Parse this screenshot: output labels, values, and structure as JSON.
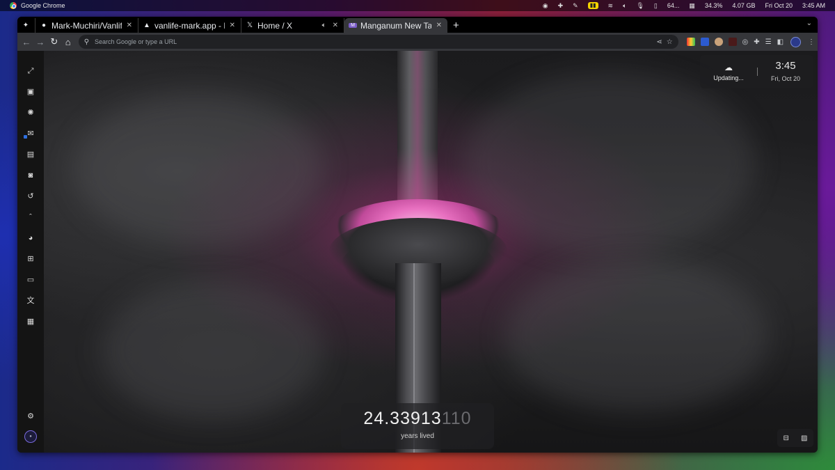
{
  "system_bar": {
    "app_name": "Google Chrome",
    "cpu": "64...",
    "disk": "34.3%",
    "memory": "4.07 GB",
    "date": "Fri Oct 20",
    "time": "3:45 AM"
  },
  "tabs": [
    {
      "title": "Mark-Muchiri/Vanlif",
      "favicon": "github-icon",
      "active": false
    },
    {
      "title": "vanlife-mark.app - D",
      "favicon": "vercel-icon",
      "active": false
    },
    {
      "title": "Home / X",
      "favicon": "x-icon",
      "active": false,
      "audio": true
    },
    {
      "title": "Manganum New Ta",
      "favicon": "manganum-icon",
      "active": true
    }
  ],
  "new_tab_symbol": "+",
  "omnibox": {
    "placeholder": "Search Google or type a URL"
  },
  "weather_widget": {
    "status": "Updating..."
  },
  "clock_widget": {
    "time": "3:45",
    "date": "Fri, Oct 20"
  },
  "age_counter": {
    "value_bright": "24.33913",
    "value_dim": "110",
    "label": "years lived"
  },
  "sidebar": {
    "items": [
      "expand-icon",
      "calendar-icon",
      "openai-icon",
      "mail-icon",
      "chat-icon",
      "contacts-icon",
      "refresh-icon",
      "collapse-icon",
      "pacman-icon",
      "calculator-icon",
      "laptop-icon",
      "translate-icon",
      "calendar-day-icon"
    ],
    "bottom": [
      "settings-icon",
      "profile-avatar"
    ]
  },
  "colors": {
    "accent": "#e870c0",
    "chrome_dark": "#202124",
    "toolbar": "#35363a"
  }
}
